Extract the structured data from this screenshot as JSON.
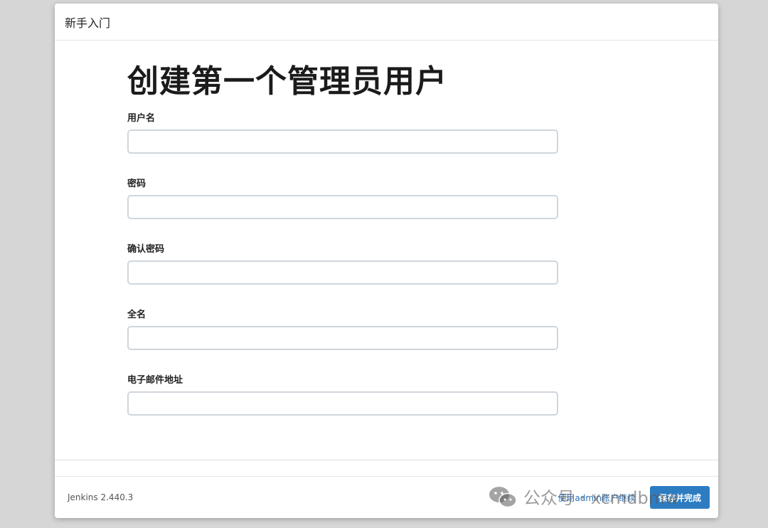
{
  "dialog": {
    "title": "新手入门"
  },
  "form": {
    "heading": "创建第一个管理员用户",
    "fields": [
      {
        "label": "用户名",
        "value": "",
        "placeholder": ""
      },
      {
        "label": "密码",
        "value": "",
        "placeholder": ""
      },
      {
        "label": "确认密码",
        "value": "",
        "placeholder": ""
      },
      {
        "label": "全名",
        "value": "",
        "placeholder": ""
      },
      {
        "label": "电子邮件地址",
        "value": "",
        "placeholder": ""
      }
    ]
  },
  "footer": {
    "version": "Jenkins 2.440.3",
    "admin_link": "使用admin账户继续",
    "save_button": "保存并完成"
  },
  "watermark": {
    "text": "公众号 · xcmdbmw",
    "icon": "wechat-icon"
  },
  "colors": {
    "primary": "#2d7cc2",
    "link": "#2b6fb5",
    "background": "#d6d6d6"
  }
}
